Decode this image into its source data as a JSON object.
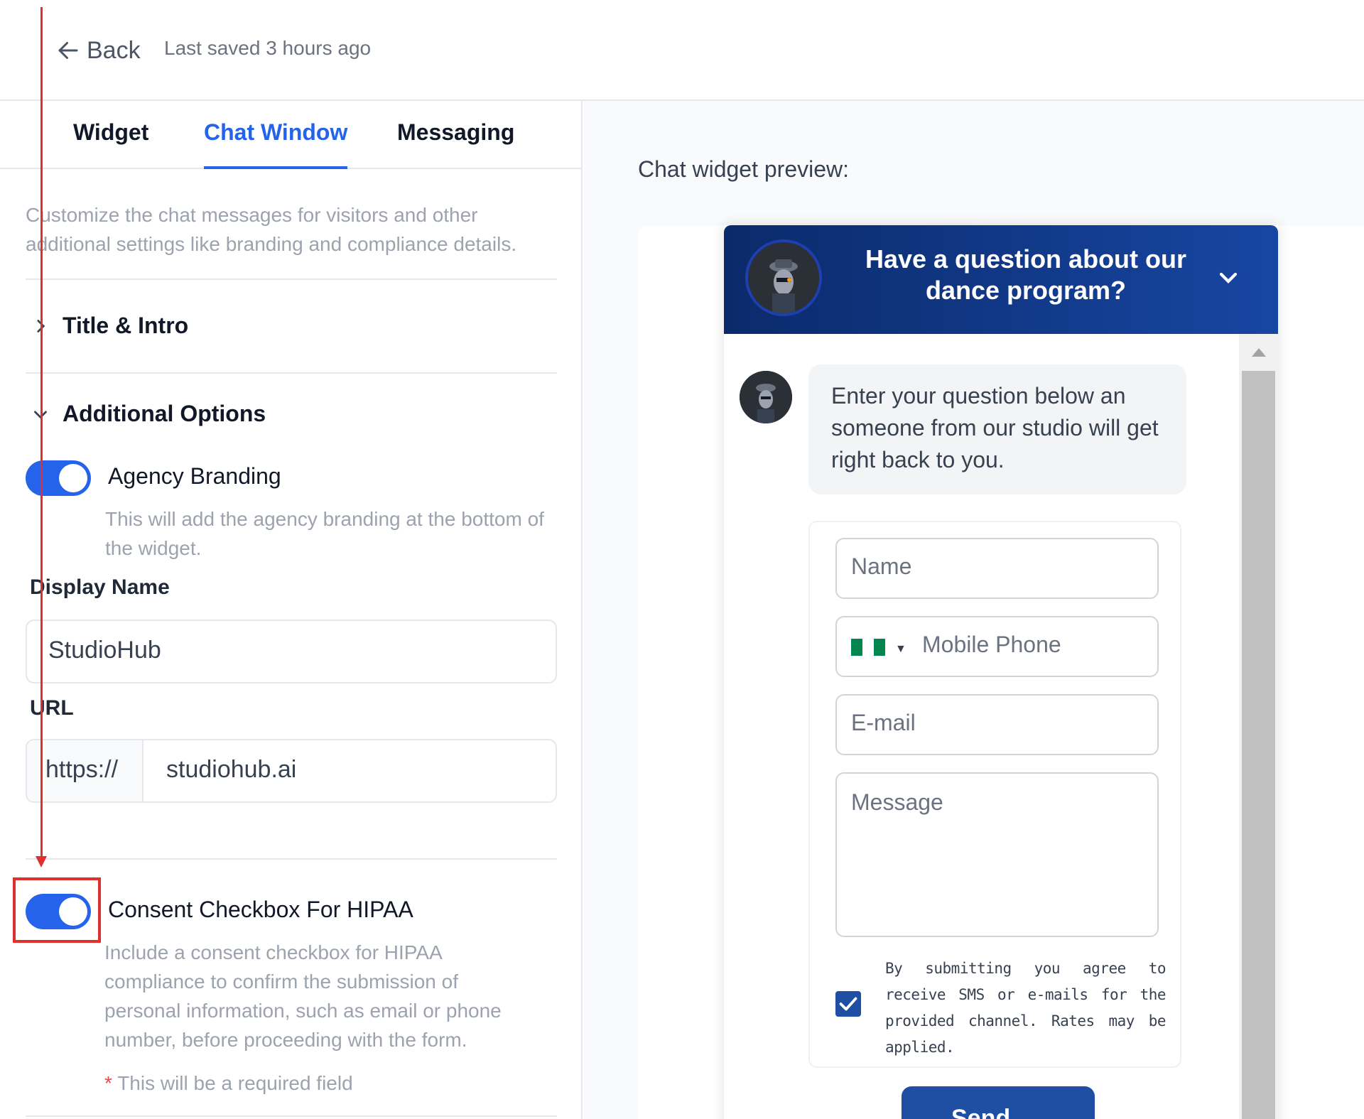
{
  "header": {
    "back_label": "Back",
    "last_saved": "Last saved 3 hours ago"
  },
  "tabs": [
    {
      "label": "Widget",
      "active": false
    },
    {
      "label": "Chat Window",
      "active": true
    },
    {
      "label": "Messaging",
      "active": false
    }
  ],
  "intro": "Customize the chat messages for visitors and other additional settings like branding and compliance details.",
  "sections": {
    "title_intro": {
      "label": "Title & Intro",
      "expanded": false
    },
    "additional_options": {
      "label": "Additional Options",
      "expanded": true
    }
  },
  "agency_branding": {
    "label": "Agency Branding",
    "enabled": true,
    "description": "This will add the agency branding at the bottom of the widget."
  },
  "display_name": {
    "label": "Display Name",
    "value": "StudioHub"
  },
  "url": {
    "label": "URL",
    "prefix": "https://",
    "value": "studiohub.ai"
  },
  "hipaa": {
    "label": "Consent Checkbox For HIPAA",
    "enabled": true,
    "description": "Include a consent checkbox for HIPAA compliance to confirm the submission of personal information, such as email or phone number, before proceeding with the form.",
    "required_note": "This will be a required field",
    "required_marker": "*"
  },
  "preview": {
    "label": "Chat widget preview:",
    "header_title": "Have a question about our dance program?",
    "bot_message": "Enter your question below an someone from our studio will get right back to you.",
    "form": {
      "name_placeholder": "Name",
      "phone_placeholder": "Mobile Phone",
      "email_placeholder": "E-mail",
      "message_placeholder": "Message",
      "consent_text": "By submitting you agree to receive SMS or e-mails for the provided channel. Rates may be applied.",
      "consent_checked": true,
      "send_label": "Send"
    }
  },
  "colors": {
    "accent": "#2563eb",
    "header_gradient_start": "#0b2a6b",
    "header_gradient_end": "#1746a2",
    "annotation": "#e0302e"
  }
}
